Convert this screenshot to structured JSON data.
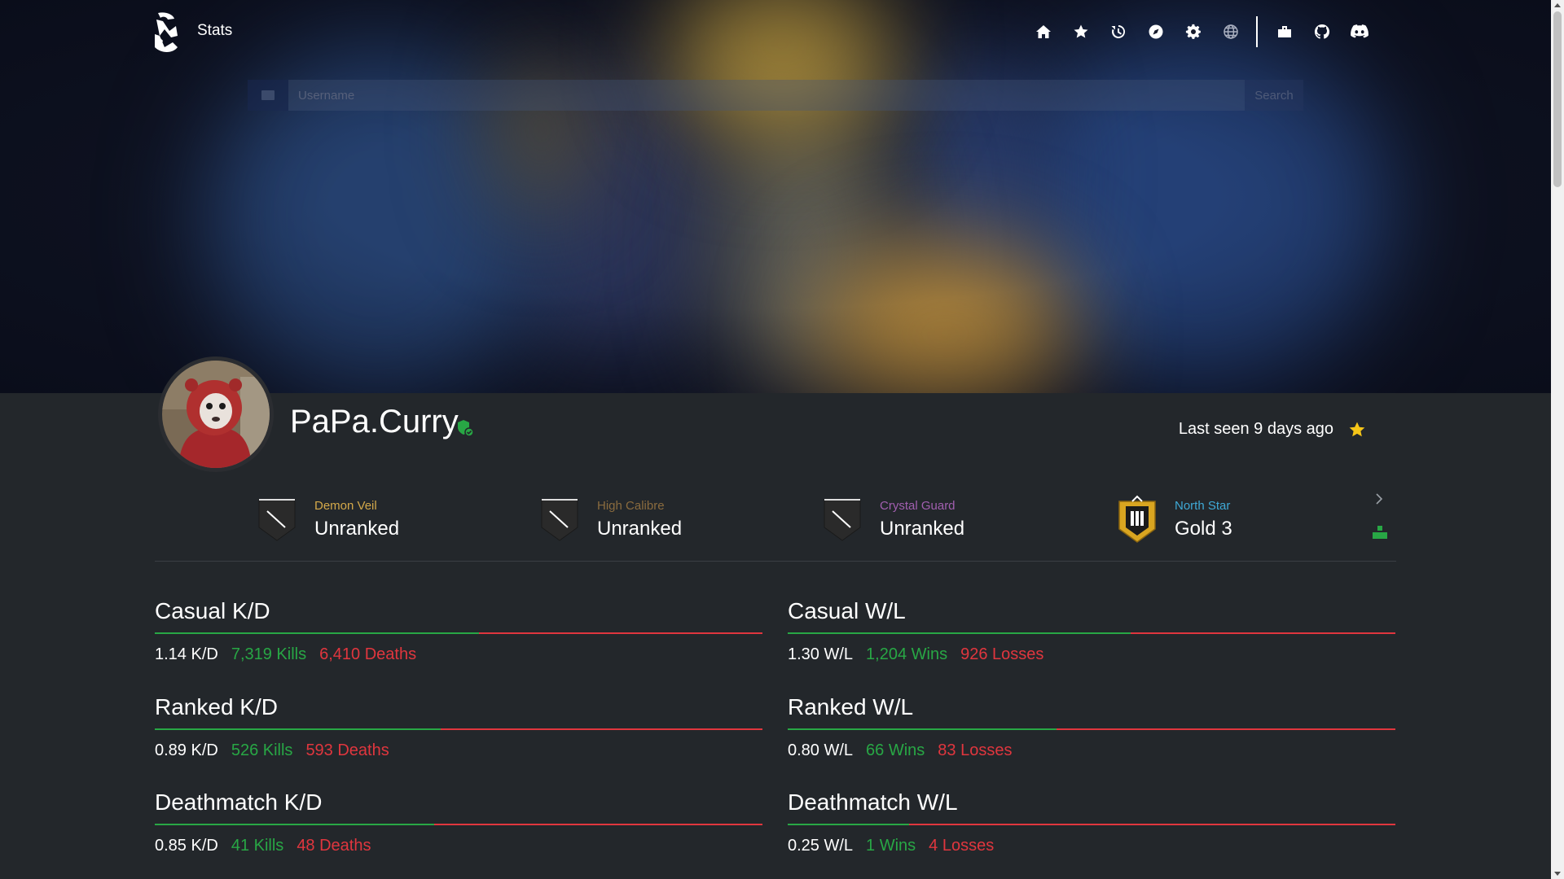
{
  "nav": {
    "brand": "Stats",
    "icons": [
      "home-icon",
      "star-icon",
      "history-icon",
      "compass-icon",
      "gear-icon",
      "globe-icon",
      "tools-icon",
      "github-icon",
      "discord-icon"
    ]
  },
  "search": {
    "placeholder": "Username",
    "button_label": "Search"
  },
  "profile": {
    "name": "PaPa.Curry",
    "last_seen": "Last seen 9 days ago"
  },
  "ranks": [
    {
      "season": "Demon Veil",
      "tier": "Unranked",
      "season_color": "#d4a94a"
    },
    {
      "season": "High Calibre",
      "tier": "Unranked",
      "season_color": "#8a6b3e"
    },
    {
      "season": "Crystal Guard",
      "tier": "Unranked",
      "season_color": "#a25fb0"
    },
    {
      "season": "North Star",
      "tier": "Gold 3",
      "season_color": "#3fa9d6"
    }
  ],
  "stats": {
    "casual_kd": {
      "title": "Casual K/D",
      "ratio": "1.14 K/D",
      "good": "7,319 Kills",
      "bad": "6,410 Deaths",
      "good_share": 0.533
    },
    "casual_wl": {
      "title": "Casual W/L",
      "ratio": "1.30 W/L",
      "good": "1,204 Wins",
      "bad": "926 Losses",
      "good_share": 0.565
    },
    "ranked_kd": {
      "title": "Ranked K/D",
      "ratio": "0.89 K/D",
      "good": "526 Kills",
      "bad": "593 Deaths",
      "good_share": 0.47
    },
    "ranked_wl": {
      "title": "Ranked W/L",
      "ratio": "0.80 W/L",
      "good": "66 Wins",
      "bad": "83 Losses",
      "good_share": 0.443
    },
    "deathmatch_kd": {
      "title": "Deathmatch K/D",
      "ratio": "0.85 K/D",
      "good": "41 Kills",
      "bad": "48 Deaths",
      "good_share": 0.46
    },
    "deathmatch_wl": {
      "title": "Deathmatch W/L",
      "ratio": "0.25 W/L",
      "good": "1 Wins",
      "bad": "4 Losses",
      "good_share": 0.2
    }
  },
  "colors": {
    "accent_good": "#28a745",
    "accent_bad": "#e0363e",
    "star": "#f5c518",
    "background": "#23272b"
  }
}
